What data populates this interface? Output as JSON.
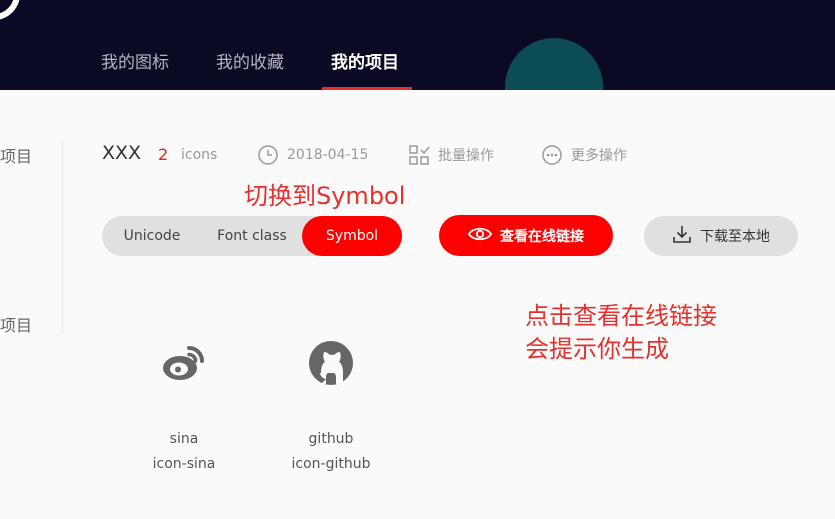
{
  "nav": {
    "items": [
      {
        "label": "我的图标"
      },
      {
        "label": "我的收藏"
      },
      {
        "label": "我的项目"
      }
    ]
  },
  "sidebar": {
    "items": [
      {
        "label": "项目"
      },
      {
        "label": "项目"
      }
    ]
  },
  "project": {
    "name": "XXX",
    "icon_count": "2",
    "icon_unit": "icons",
    "date": "2018-04-15",
    "batch_label": "批量操作",
    "more_label": "更多操作"
  },
  "annotations": {
    "switch_note": "切换到Symbol",
    "view_note_line1": "点击查看在线链接",
    "view_note_line2": "会提示你生成"
  },
  "segment": {
    "options": [
      {
        "label": "Unicode"
      },
      {
        "label": "Font class"
      },
      {
        "label": "Symbol"
      }
    ],
    "selected": "Symbol"
  },
  "buttons": {
    "view_online": "查看在线链接",
    "download": "下载至本地"
  },
  "icons": [
    {
      "name": "sina",
      "code": "icon-sina",
      "icon": "weibo-icon"
    },
    {
      "name": "github",
      "code": "icon-github",
      "icon": "github-icon"
    }
  ],
  "colors": {
    "header_bg": "#0b0a25",
    "accent": "#ff0000",
    "annotation": "#e5312d",
    "icon": "#666666"
  }
}
